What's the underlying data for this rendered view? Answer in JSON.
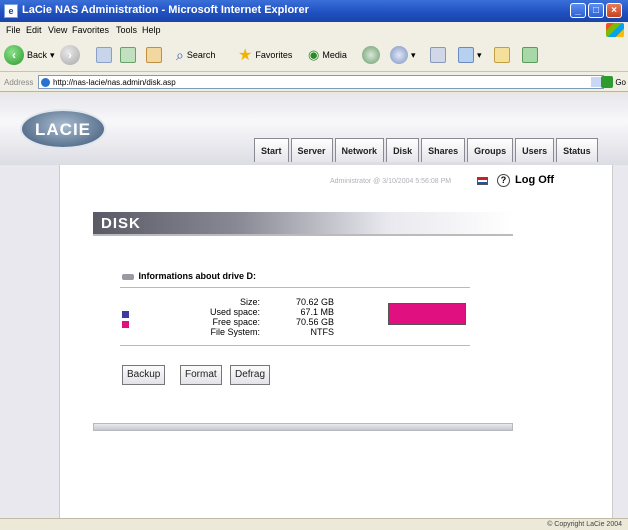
{
  "window": {
    "title": "LaCie NAS Administration - Microsoft Internet Explorer"
  },
  "menu": {
    "file": "File",
    "edit": "Edit",
    "view": "View",
    "favorites": "Favorites",
    "tools": "Tools",
    "help": "Help"
  },
  "toolbar": {
    "back": "Back",
    "search": "Search",
    "favorites": "Favorites",
    "media": "Media"
  },
  "address": {
    "label": "Address",
    "url": "http://nas-lacie/nas.admin/disk.asp",
    "go": "Go"
  },
  "brand": {
    "logo_text": "LACIE"
  },
  "tabs": [
    {
      "label": "Start"
    },
    {
      "label": "Server"
    },
    {
      "label": "Network"
    },
    {
      "label": "Disk"
    },
    {
      "label": "Shares"
    },
    {
      "label": "Groups"
    },
    {
      "label": "Users"
    },
    {
      "label": "Status"
    }
  ],
  "user": {
    "line": "Administrator @ 3/10/2004 5:56:08 PM",
    "logoff": "Log Off",
    "help": "?"
  },
  "section": {
    "title": "DISK"
  },
  "drive": {
    "heading": "Informations about drive D:",
    "rows": [
      {
        "label": "Size:",
        "value": "70.62 GB"
      },
      {
        "label": "Used space:",
        "value": "67.1 MB"
      },
      {
        "label": "Free space:",
        "value": "70.56 GB"
      },
      {
        "label": "File System:",
        "value": "NTFS"
      }
    ],
    "used_color": "#3c3c9a",
    "free_color": "#e01080"
  },
  "buttons": {
    "backup": "Backup",
    "format": "Format",
    "defrag": "Defrag"
  },
  "status": {
    "copyright": "© Copyright LaCie 2004"
  }
}
